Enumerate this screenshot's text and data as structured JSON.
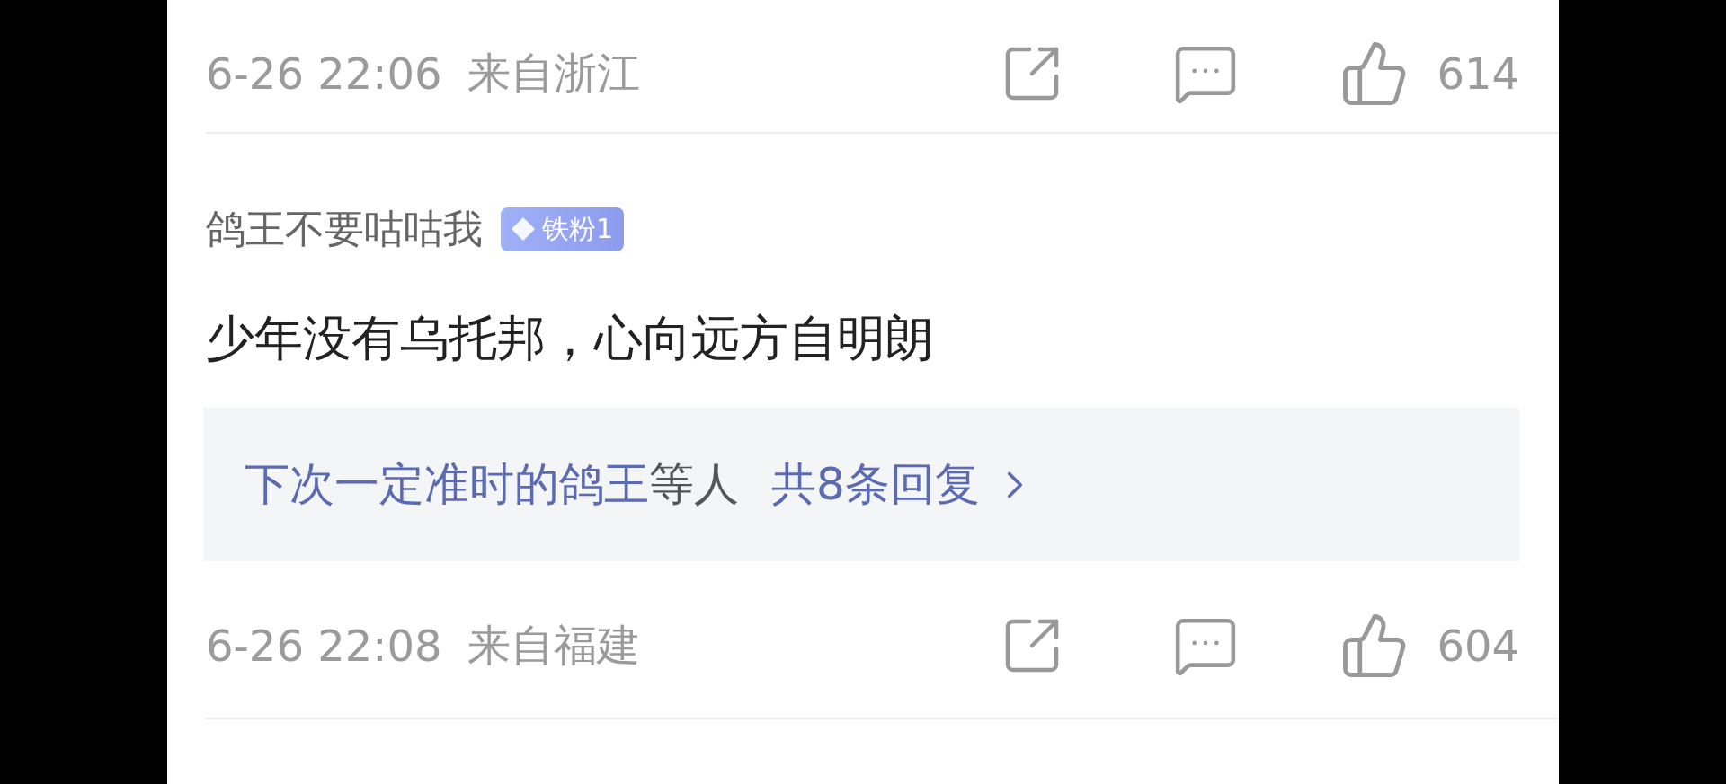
{
  "top_footer": {
    "time": "6-26 22:06",
    "location": "来自浙江",
    "likes": "614"
  },
  "comment": {
    "username": "鸽王不要咕咕我",
    "badge": "铁粉1",
    "text": "少年没有乌托邦，心向远方自明朗",
    "replies": {
      "names": "下次一定准时的鸽王",
      "suffix": "等人",
      "count": "共8条回复"
    },
    "footer": {
      "time": "6-26 22:08",
      "location": "来自福建",
      "likes": "604"
    }
  }
}
